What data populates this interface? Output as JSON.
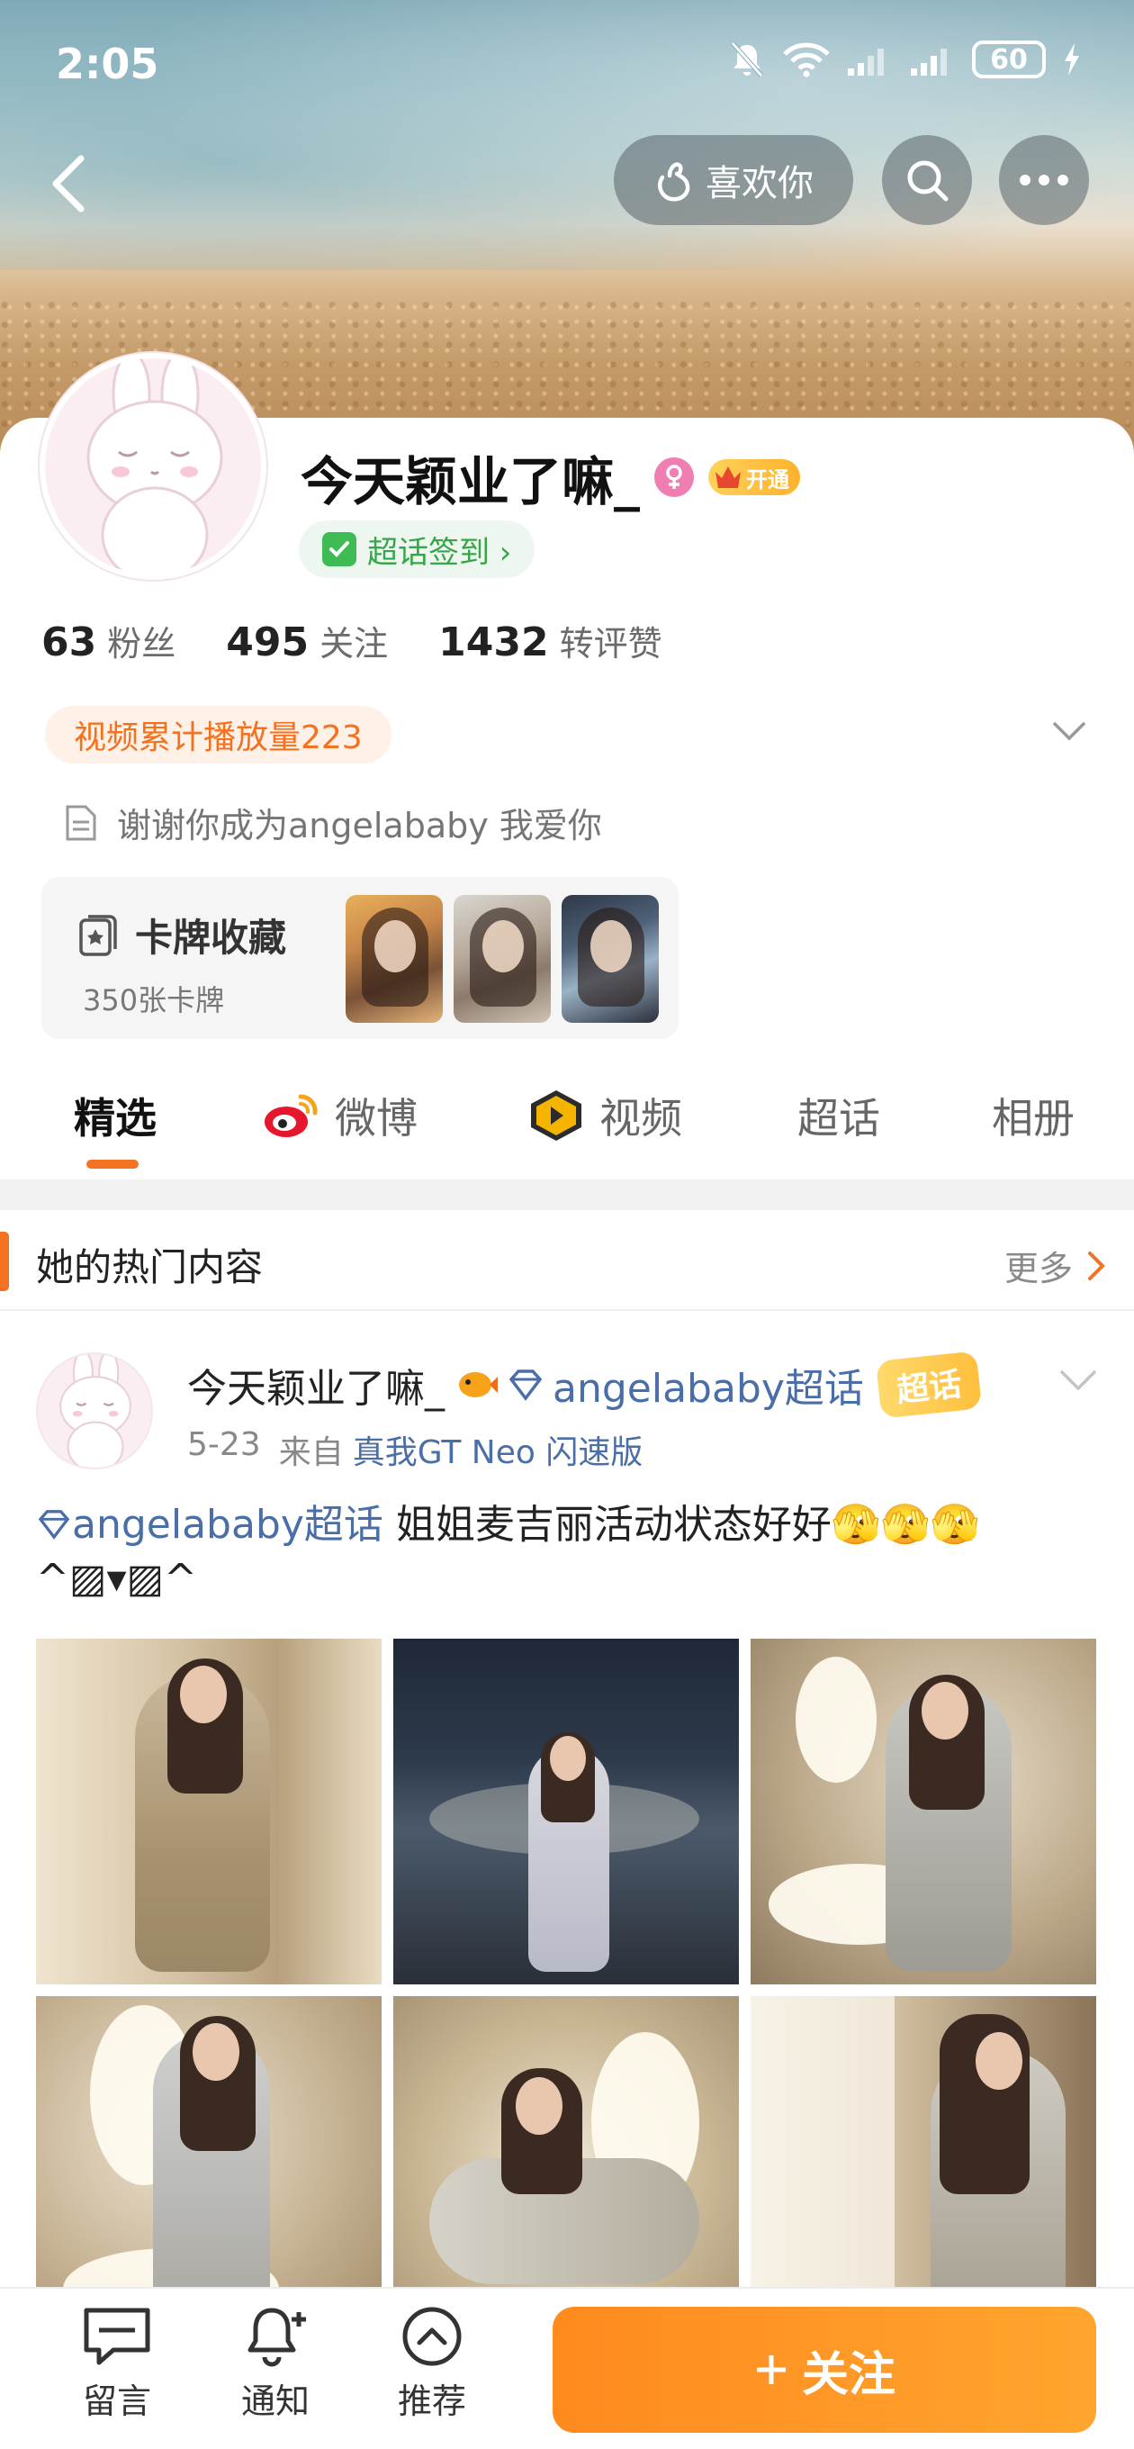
{
  "status_bar": {
    "time": "2:05",
    "battery": "60"
  },
  "header": {
    "like_label": "喜欢你"
  },
  "profile": {
    "nickname": "今天颖业了嘛_",
    "vip_label": "开通",
    "checkin_label": "超话签到 ›",
    "stats": [
      {
        "num": "63",
        "label": "粉丝"
      },
      {
        "num": "495",
        "label": "关注"
      },
      {
        "num": "1432",
        "label": "转评赞"
      }
    ],
    "views_badge": "视频累计播放量223",
    "bio": "谢谢你成为angelababy 我爱你",
    "cards": {
      "title": "卡牌收藏",
      "count": "350张卡牌"
    }
  },
  "tabs": [
    {
      "label": "精选"
    },
    {
      "label": "微博"
    },
    {
      "label": "视频"
    },
    {
      "label": "超话"
    },
    {
      "label": "相册"
    }
  ],
  "hot_section": {
    "title": "她的热门内容",
    "more": "更多"
  },
  "post": {
    "author": "今天颖业了嘛_",
    "topic": "angelababy超话",
    "superchat_badge": "超话",
    "date": "5-23",
    "source_prefix": "来自",
    "device": "真我GT Neo 闪速版",
    "text_topic": "angelababy超话",
    "text_body": "  姐姐麦吉丽活动状态好好🫣🫣🫣",
    "text_emote": "^▨▾▨^"
  },
  "bottom_bar": {
    "message": "留言",
    "notify": "通知",
    "recommend": "推荐",
    "follow": "关注"
  },
  "colors": {
    "accent": "#f47323",
    "link": "#4a6ea8",
    "checkin_green": "#37a54a"
  }
}
